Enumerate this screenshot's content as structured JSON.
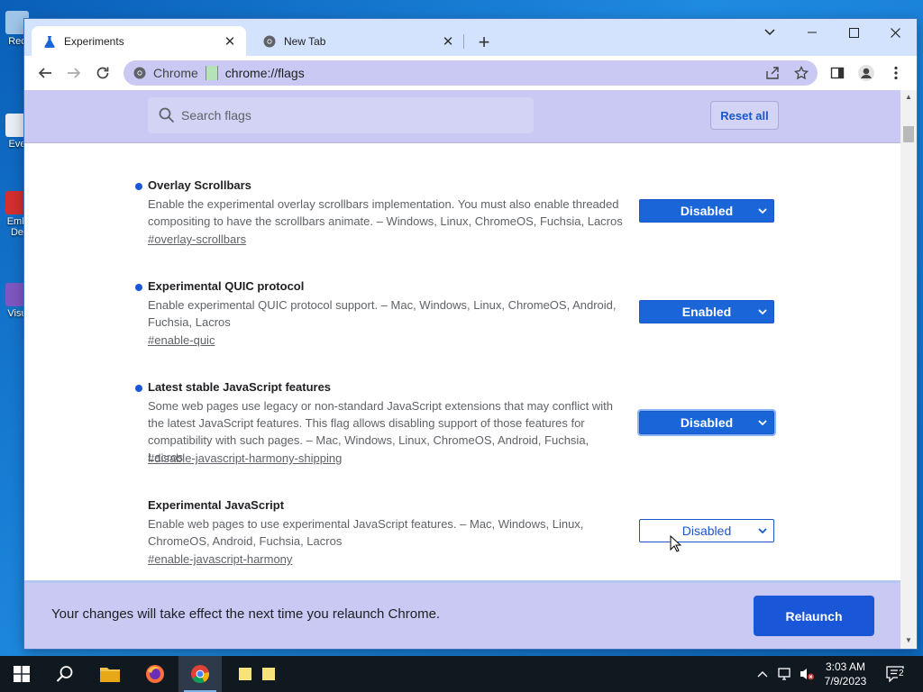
{
  "desktop": {
    "icons": [
      {
        "label": "Rec",
        "color": "#9fc5e8"
      },
      {
        "label": "Eve",
        "color": "#e8eef5"
      },
      {
        "label": "Emb De",
        "color": "#d32f2f"
      },
      {
        "label": "Visu",
        "color": "#7e57c2"
      }
    ]
  },
  "browser": {
    "tabs": [
      {
        "title": "Experiments",
        "icon": "flask-icon",
        "active": true
      },
      {
        "title": "New Tab",
        "icon": "chrome-icon",
        "active": false
      }
    ],
    "address": {
      "prefix": "Chrome",
      "url": "chrome://flags"
    }
  },
  "flags_page": {
    "search_placeholder": "Search flags",
    "reset_label": "Reset all",
    "flags": [
      {
        "name": "Overlay Scrollbars",
        "description": "Enable the experimental overlay scrollbars implementation. You must also enable threaded compositing to have the scrollbars animate. – Windows, Linux, ChromeOS, Fuchsia, Lacros",
        "link": "#overlay-scrollbars",
        "value": "Disabled",
        "modified": true
      },
      {
        "name": "Experimental QUIC protocol",
        "description": "Enable experimental QUIC protocol support. – Mac, Windows, Linux, ChromeOS, Android, Fuchsia, Lacros",
        "link": "#enable-quic",
        "value": "Enabled",
        "modified": true
      },
      {
        "name": "Latest stable JavaScript features",
        "description": "Some web pages use legacy or non-standard JavaScript extensions that may conflict with the latest JavaScript features. This flag allows disabling support of those features for compatibility with such pages. – Mac, Windows, Linux, ChromeOS, Android, Fuchsia, Lacros",
        "link": "#disable-javascript-harmony-shipping",
        "value": "Disabled",
        "modified": true
      },
      {
        "name": "Experimental JavaScript",
        "description": "Enable web pages to use experimental JavaScript features. – Mac, Windows, Linux, ChromeOS, Android, Fuchsia, Lacros",
        "link": "#enable-javascript-harmony",
        "value": "Disabled",
        "modified": false
      }
    ],
    "relaunch_message": "Your changes will take effect the next time you relaunch Chrome.",
    "relaunch_label": "Relaunch"
  },
  "taskbar": {
    "time": "3:03 AM",
    "date": "7/9/2023",
    "notification_count": "2"
  },
  "colors": {
    "accent": "#1a57d8",
    "header_bg": "#c9c9f3",
    "tabstrip": "#d3e3fd"
  }
}
